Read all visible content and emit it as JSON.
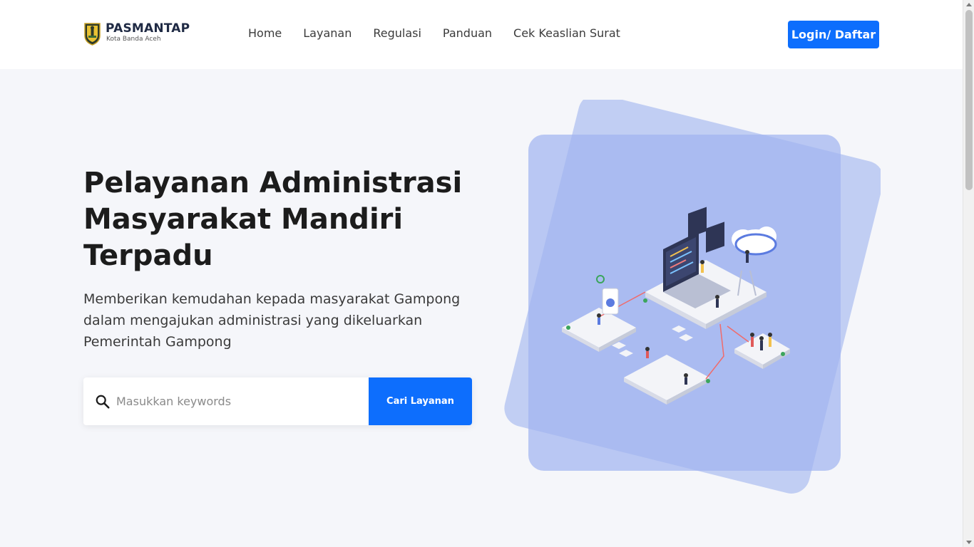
{
  "brand": {
    "name": "PASMANTAP",
    "tagline": "Kota Banda Aceh"
  },
  "nav": {
    "items": [
      "Home",
      "Layanan",
      "Regulasi",
      "Panduan",
      "Cek Keaslian Surat"
    ]
  },
  "header": {
    "login_label": "Login/ Daftar"
  },
  "hero": {
    "title": "Pelayanan Administrasi Masyarakat Mandiri Terpadu",
    "description": "Memberikan kemudahan kepada masyarakat Gampong dalam mengajukan administrasi yang dikeluarkan Pemerintah Gampong"
  },
  "search": {
    "placeholder": "Masukkan keywords",
    "value": "",
    "button_label": "Cari Layanan"
  },
  "colors": {
    "accent": "#0d6efd",
    "background": "#f5f6fa",
    "illustration_square": "#9fb4ef"
  },
  "icons": {
    "search": "search-icon",
    "logo": "coat-of-arms-icon"
  }
}
